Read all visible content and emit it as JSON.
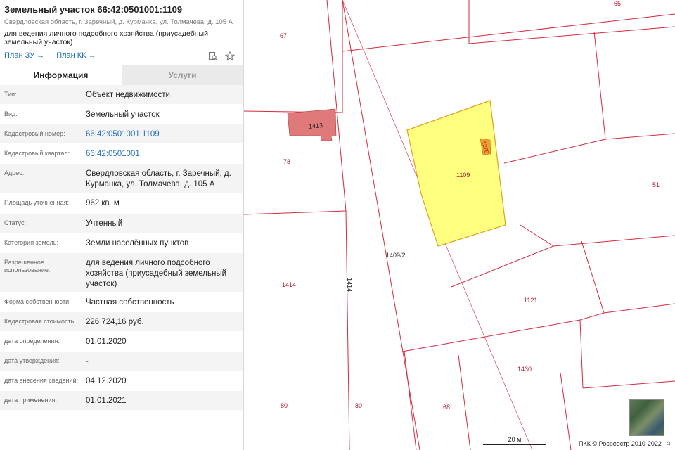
{
  "header": {
    "title": "Земельный участок 66:42:0501001:1109",
    "address": "Свердловская область, г. Заречный, д. Курманка, ул. Толмачева, д. 105 А",
    "usage": "для ведения личного подсобного хозяйства (приусадебный земельный участок)",
    "link_plan_zu": "План ЗУ →",
    "link_plan_kk": "План КК →",
    "icons": [
      "search-document-icon",
      "star-icon"
    ]
  },
  "tabs": [
    {
      "label": "Информация",
      "active": true
    },
    {
      "label": "Услуги",
      "active": false
    }
  ],
  "info_rows": [
    {
      "label": "Тип:",
      "value": "Объект недвижимости"
    },
    {
      "label": "Вид:",
      "value": "Земельный участок"
    },
    {
      "label": "Кадастровый номер:",
      "value": "66:42:0501001:1109",
      "link": true
    },
    {
      "label": "Кадастровый квартал:",
      "value": "66:42:0501001",
      "link": true
    },
    {
      "label": "Адрес:",
      "value": "Свердловская область, г. Заречный, д. Курманка, ул. Толмачева, д. 105 А"
    },
    {
      "label": "Площадь уточненная:",
      "value": "962 кв. м"
    },
    {
      "label": "Статус:",
      "value": "Учтенный"
    },
    {
      "label": "Категория земель:",
      "value": "Земли населённых пунктов"
    },
    {
      "label": "Разрешенное использование:",
      "value": "для ведения личного подсобного хозяйства (приусадебный земельный участок)"
    },
    {
      "label": "Форма собственности:",
      "value": "Частная собственность"
    },
    {
      "label": "Кадастровая стоимость:",
      "value": "226 724,16 руб."
    },
    {
      "label": "дата определения:",
      "value": "01.01.2020"
    },
    {
      "label": "дата утверждения:",
      "value": "-"
    },
    {
      "label": "дата внесения сведений:",
      "value": "04.12.2020"
    },
    {
      "label": "дата применения:",
      "value": "01.01.2021"
    }
  ],
  "map": {
    "parcel_labels": [
      "65",
      "67",
      "1413",
      "78",
      "1109",
      "1276",
      "51",
      "1409/2",
      "1414",
      "1414",
      "1121",
      "1430",
      "80",
      "80",
      "68"
    ],
    "scale_label": "20 м",
    "copyright": "ПКК © Росреестр 2010-2022",
    "home_icon": "⌂",
    "colors": {
      "boundary": "#d42a3f",
      "selected_fill": "#ffff7f",
      "selected_stroke": "#e0a020",
      "building": "#e07a7a",
      "small_building": "#f0a030"
    }
  }
}
